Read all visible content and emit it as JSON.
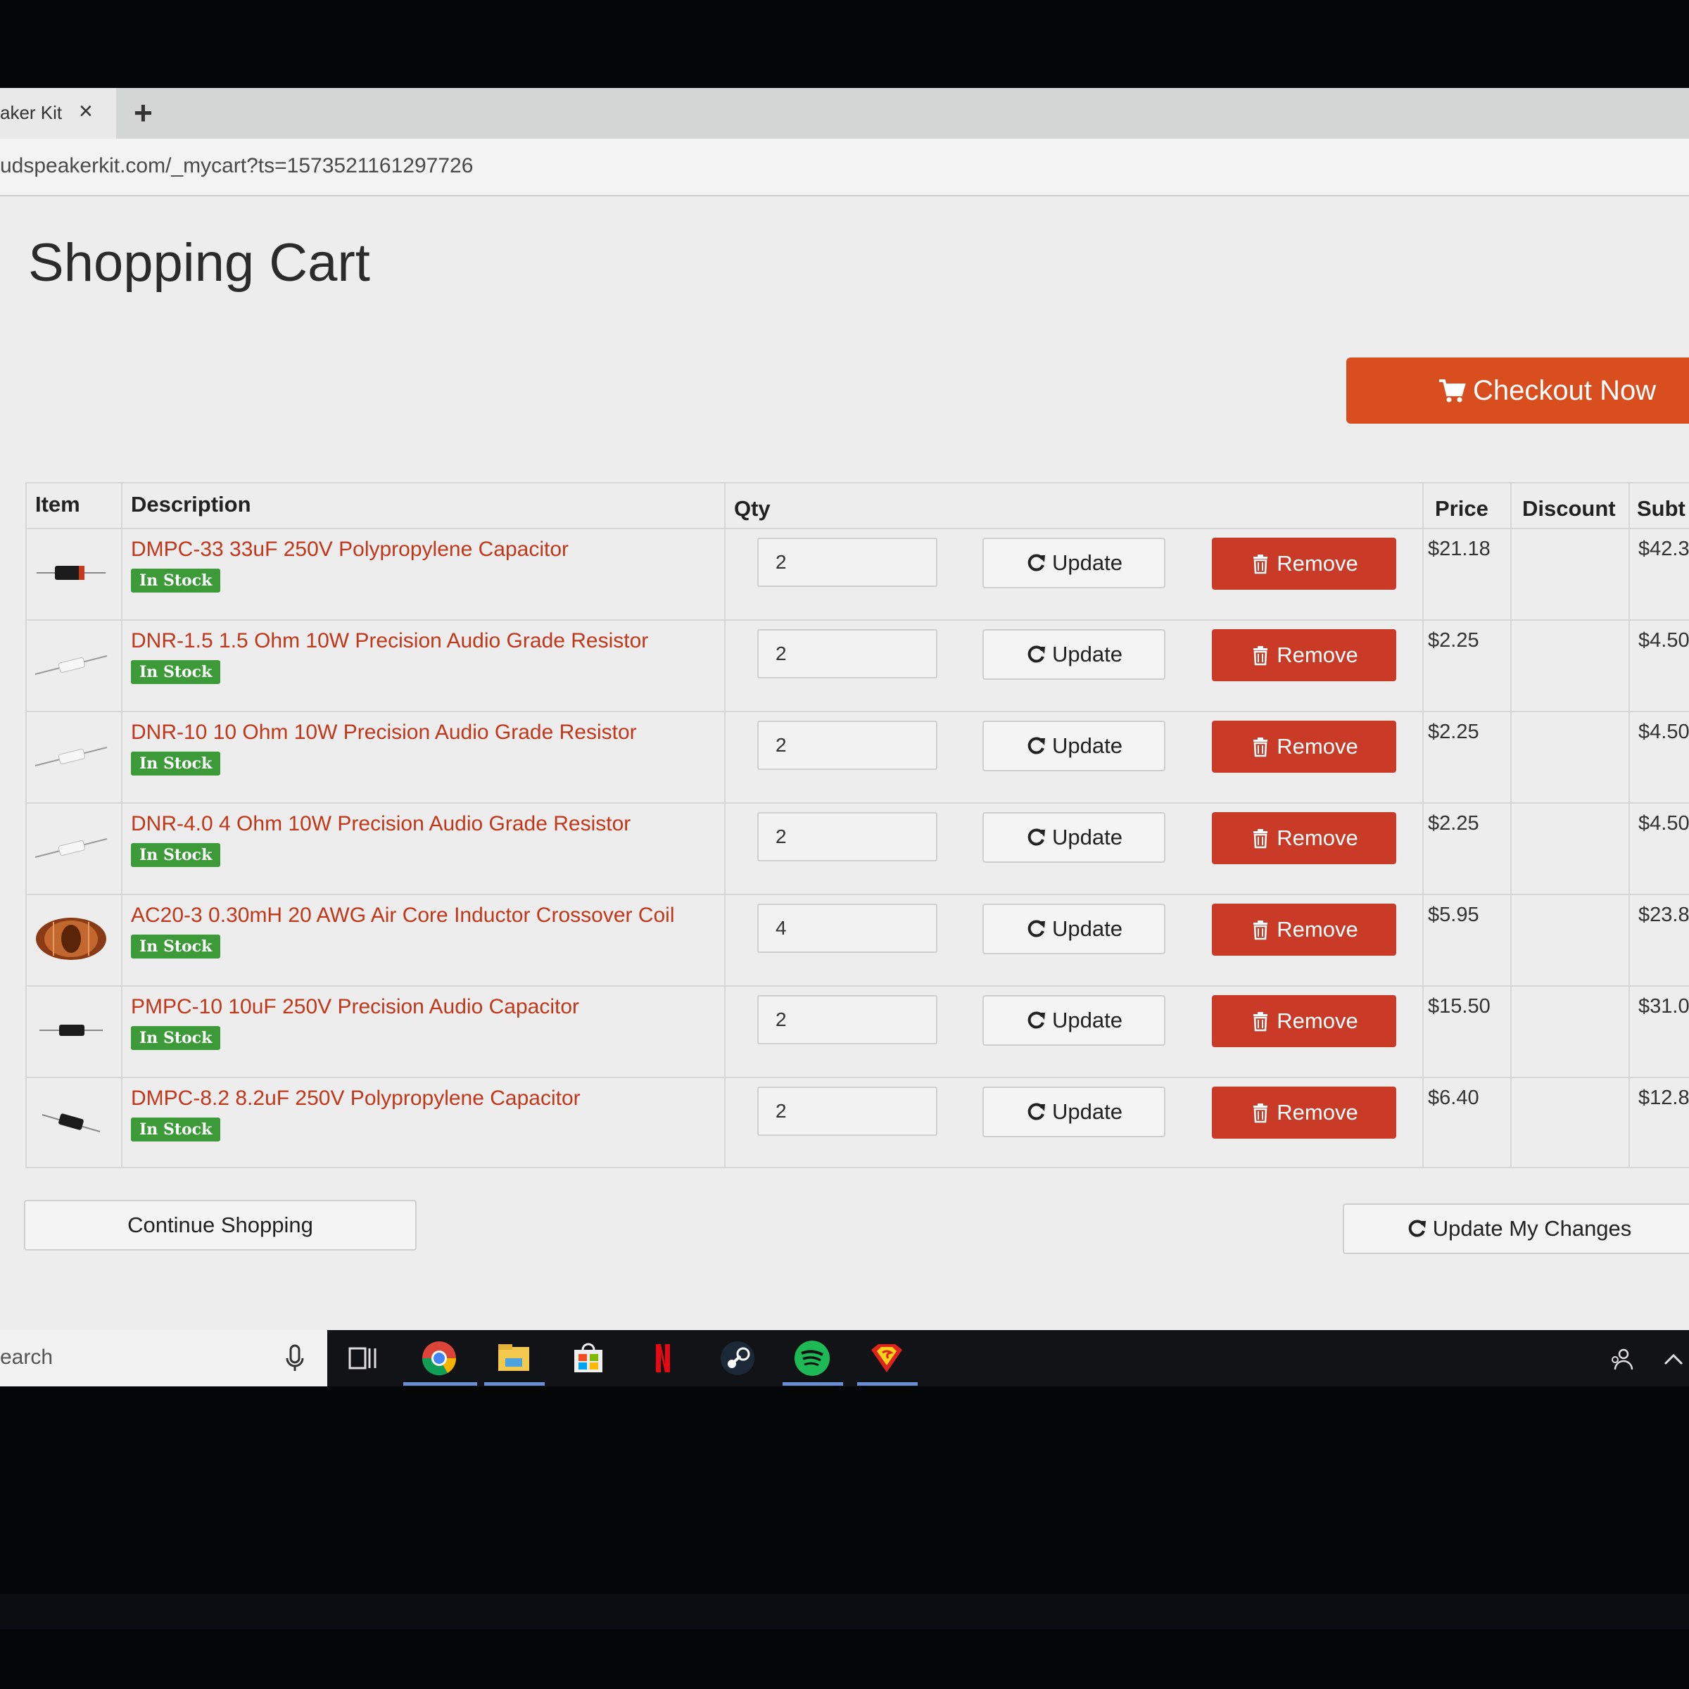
{
  "browser": {
    "tab_title": "aker Kit",
    "tab_close": "×",
    "new_tab": "+",
    "url": "udspeakerkit.com/_mycart?ts=1573521161297726"
  },
  "page": {
    "title": "Shopping Cart",
    "checkout_label": "Checkout Now"
  },
  "table": {
    "headers": {
      "item": "Item",
      "description": "Description",
      "qty": "Qty",
      "price": "Price",
      "discount": "Discount",
      "subtotal": "Subt"
    },
    "update_label": "Update",
    "remove_label": "Remove",
    "rows": [
      {
        "description": "DMPC-33 33uF 250V Polypropylene Capacitor",
        "stock": "In Stock",
        "qty": "2",
        "price": "$21.18",
        "subtotal": "$42.3"
      },
      {
        "description": "DNR-1.5 1.5 Ohm 10W Precision Audio Grade Resistor",
        "stock": "In Stock",
        "qty": "2",
        "price": "$2.25",
        "subtotal": "$4.50"
      },
      {
        "description": "DNR-10 10 Ohm 10W Precision Audio Grade Resistor",
        "stock": "In Stock",
        "qty": "2",
        "price": "$2.25",
        "subtotal": "$4.50"
      },
      {
        "description": "DNR-4.0 4 Ohm 10W Precision Audio Grade Resistor",
        "stock": "In Stock",
        "qty": "2",
        "price": "$2.25",
        "subtotal": "$4.50"
      },
      {
        "description": "AC20-3 0.30mH 20 AWG Air Core Inductor Crossover Coil",
        "stock": "In Stock",
        "qty": "4",
        "price": "$5.95",
        "subtotal": "$23.8"
      },
      {
        "description": "PMPC-10 10uF 250V Precision Audio Capacitor",
        "stock": "In Stock",
        "qty": "2",
        "price": "$15.50",
        "subtotal": "$31.0"
      },
      {
        "description": "DMPC-8.2 8.2uF 250V Polypropylene Capacitor",
        "stock": "In Stock",
        "qty": "2",
        "price": "$6.40",
        "subtotal": "$12.8"
      }
    ]
  },
  "footer": {
    "continue_label": "Continue Shopping",
    "update_changes_label": "Update My Changes"
  },
  "taskbar": {
    "search_text": "earch",
    "icons": [
      "task-view-icon",
      "chrome-icon",
      "file-explorer-icon",
      "store-icon",
      "netflix-icon",
      "steam-icon",
      "spotify-icon",
      "superman-icon"
    ]
  },
  "colors": {
    "accent_orange": "#d94e1f",
    "remove_red": "#c93a27",
    "in_stock_green": "#3c9a38",
    "link_red": "#c1371a"
  }
}
